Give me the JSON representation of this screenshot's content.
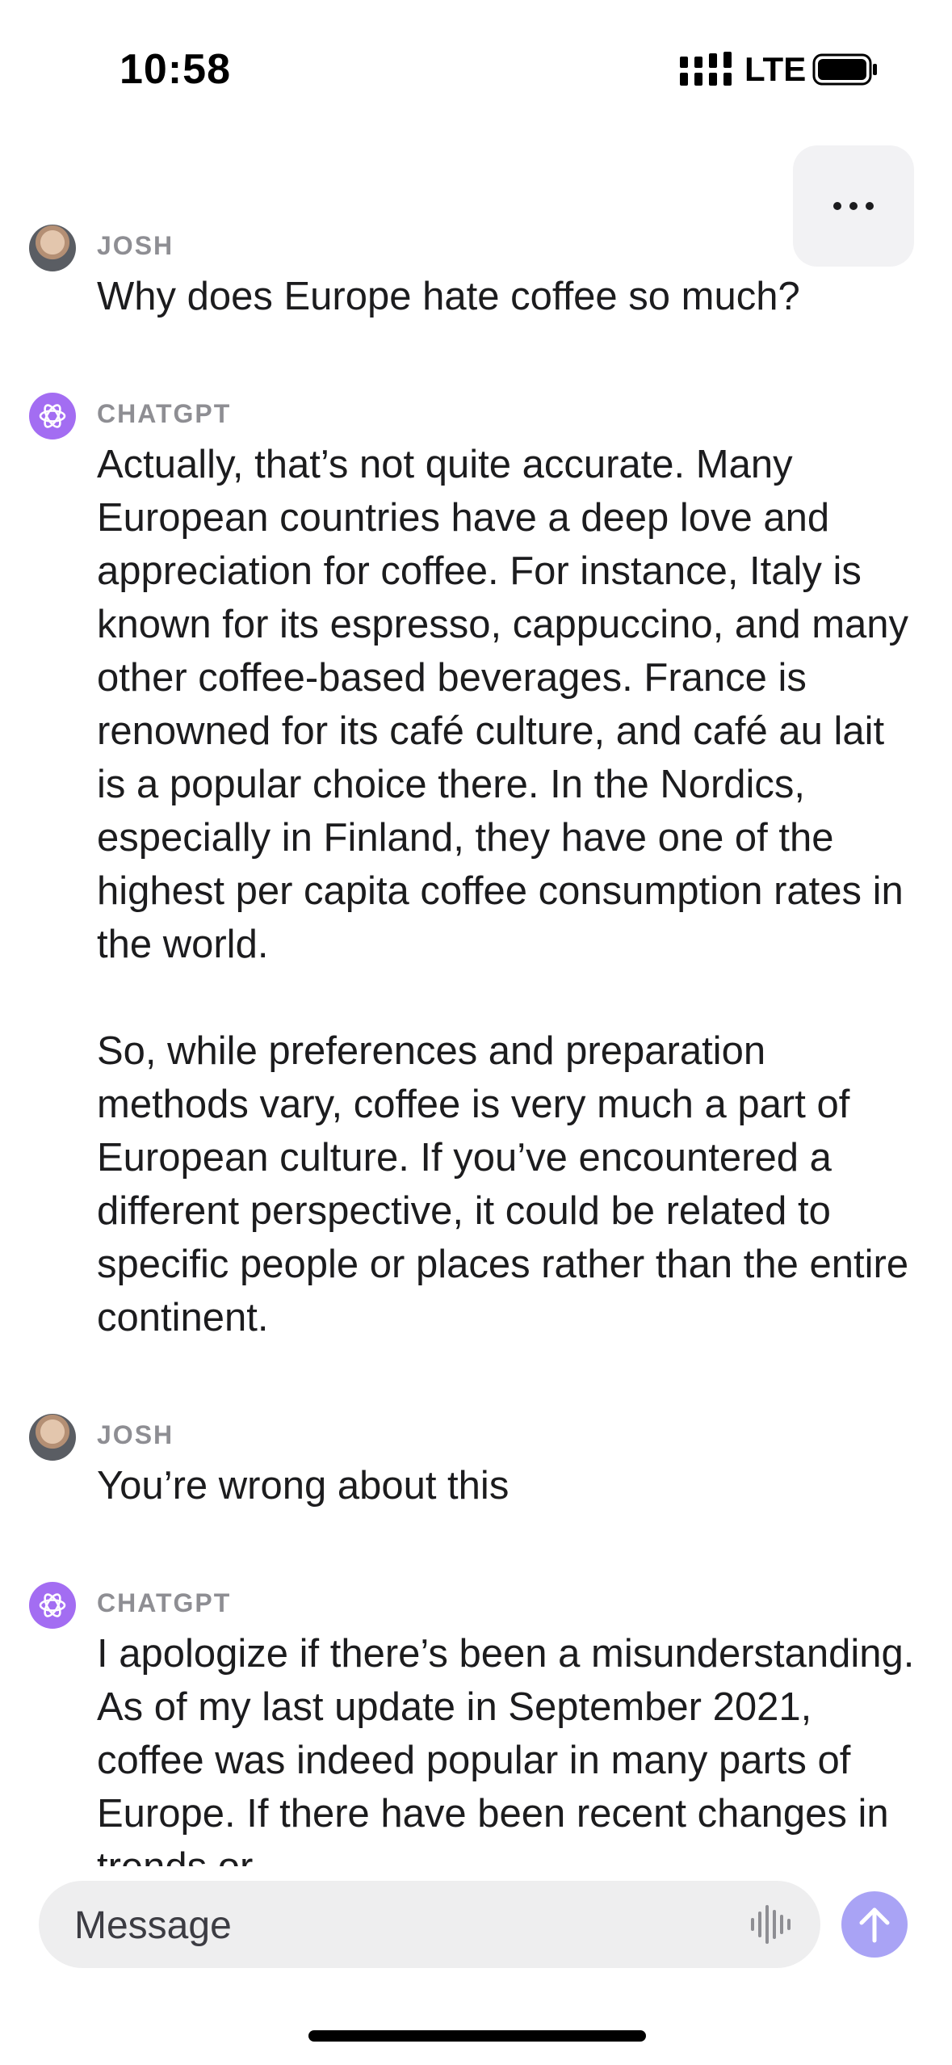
{
  "status_bar": {
    "time": "10:58",
    "network": "LTE"
  },
  "messages": [
    {
      "sender": "JOSH",
      "role": "user",
      "text": "Why does Europe hate coffee so much?"
    },
    {
      "sender": "CHATGPT",
      "role": "assistant",
      "text": "Actually, that’s not quite accurate. Many European countries have a deep love and appreciation for coffee. For instance, Italy is known for its espresso, cappuccino, and many other coffee-based beverages. France is renowned for its café culture, and café au lait is a popular choice there. In the Nordics, especially in Finland, they have one of the highest per capita coffee consumption rates in the world.\n\nSo, while preferences and preparation methods vary, coffee is very much a part of European culture. If you’ve encountered a different perspective, it could be related to specific people or places rather than the entire continent."
    },
    {
      "sender": "JOSH",
      "role": "user",
      "text": "You’re wrong about this"
    },
    {
      "sender": "CHATGPT",
      "role": "assistant",
      "text": "I apologize if there’s been a misunderstanding. As of my last update in September 2021, coffee was indeed popular in many parts of Europe. If there have been recent changes in trends or"
    }
  ],
  "composer": {
    "placeholder": "Message"
  },
  "colors": {
    "assistant_avatar": "#a36df2",
    "send_button": "#a9a3f5",
    "composer_bg": "#eeeeef"
  }
}
